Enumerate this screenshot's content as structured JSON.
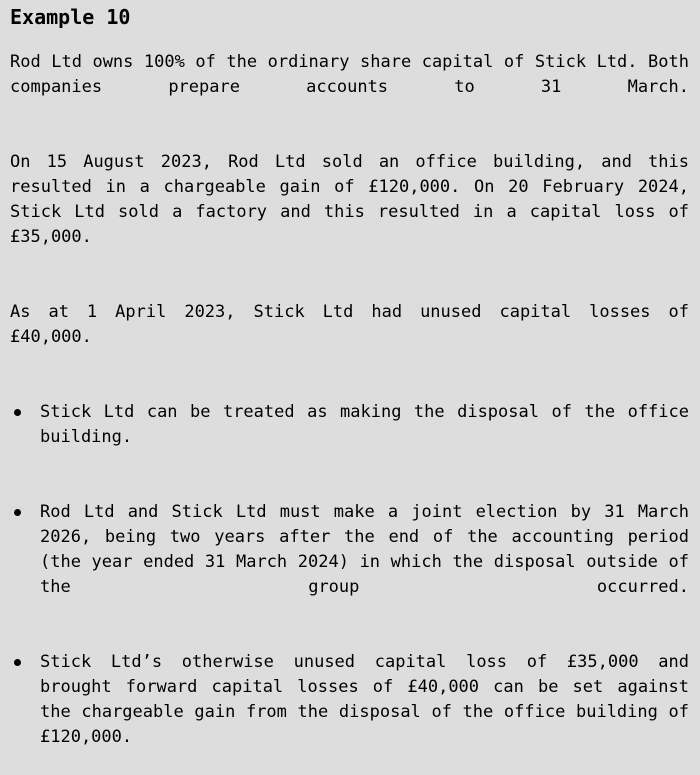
{
  "document": {
    "title": "Example 10",
    "background_color": "#dddddd",
    "text_color": "#000000",
    "paragraphs": [
      "Rod Ltd owns 100% of the ordinary share capital of Stick Ltd. Both companies prepare accounts to 31 March.",
      "On 15 August 2023, Rod Ltd sold an office building, and this resulted in a chargeable gain of £120,000. On 20 February 2024, Stick Ltd sold a factory and this resulted in a capital loss of £35,000.",
      "As at 1 April 2023, Stick Ltd had unused capital losses of £40,000."
    ],
    "bullets": [
      "Stick Ltd can be treated as making the disposal of the office building.",
      "Rod Ltd and Stick Ltd must make a joint election by 31 March 2026, being two years after the end of the accounting period (the year ended 31 March 2024) in which the disposal outside of the group occurred.",
      "Stick Ltd’s otherwise unused capital loss of £35,000 and brought forward capital losses of £40,000 can be set against the chargeable gain from the disposal of the office building of £120,000."
    ]
  }
}
